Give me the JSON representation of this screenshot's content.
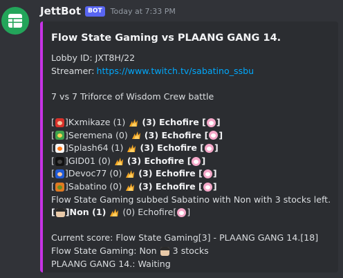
{
  "message": {
    "username": "JettBot",
    "bot_tag": "BOT",
    "timestamp": "Today at 7:33 PM",
    "avatar_icon": "spreadsheet-icon",
    "accent_color": "#c633e6"
  },
  "embed": {
    "title": "Flow State Gaming vs PLAANG GANG 14.",
    "lobby_label": "Lobby ID: JXT8H/22",
    "streamer_label": "Streamer: ",
    "streamer_url": "https://www.twitch.tv/sabatino_ssbu",
    "battle_type": "7 vs 7 Triforce of Wisdom Crew battle",
    "matches": [
      {
        "player": "Kxmikaze (1)",
        "player_icon": "mario-icon",
        "opponent": "(3) Echofire",
        "opponent_icon": "jigglypuff-icon"
      },
      {
        "player": "Seremena (0)",
        "player_icon": "bowser-icon",
        "opponent": "(3) Echofire",
        "opponent_icon": "jigglypuff-icon"
      },
      {
        "player": "Splash64 (1)",
        "player_icon": "inkling-icon",
        "opponent": "(3) Echofire",
        "opponent_icon": "jigglypuff-icon"
      },
      {
        "player": "GID01 (0)",
        "player_icon": "game-and-watch-icon",
        "opponent": "(3) Echofire",
        "opponent_icon": "jigglypuff-icon"
      },
      {
        "player": "Devoc77 (0)",
        "player_icon": "sonic-icon",
        "opponent": "(3) Echofire",
        "opponent_icon": "jigglypuff-icon"
      },
      {
        "player": "Sabatino (0)",
        "player_icon": "king-k-rool-icon",
        "opponent": "(3) Echofire",
        "opponent_icon": "jigglypuff-icon"
      }
    ],
    "sub_note": "Flow State Gaming subbed Sabatino with Non with 3 stocks left.",
    "last_match": {
      "player": "Non (1)",
      "player_icon": "mii-brawler-icon",
      "opponent": "(0) Echofire",
      "opponent_icon": "jigglypuff-icon"
    },
    "current_score": "Current score: Flow State Gaming[3] - PLAANG GANG 14.[18]",
    "team1_status_prefix": "Flow State Gaming: Non",
    "team1_status_suffix": "3 stocks",
    "team2_status": "PLAANG GANG 14.: Waiting",
    "versus_icon": "fire-icon"
  }
}
